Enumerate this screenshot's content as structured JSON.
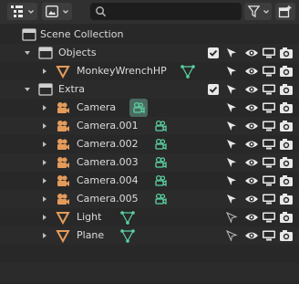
{
  "header": {
    "display_mode_icon": "outliner-icon",
    "filter_icon": "funnel-icon",
    "new_collection_icon": "new-collection-icon",
    "search": {
      "value": "",
      "placeholder": ""
    }
  },
  "tree": {
    "root": {
      "label": "Scene Collection"
    },
    "objects_collection": {
      "label": "Objects"
    },
    "monkey": {
      "label": "MonkeyWrenchHP"
    },
    "extra_collection": {
      "label": "Extra"
    },
    "camera": {
      "label": "Camera"
    },
    "camera001": {
      "label": "Camera.001"
    },
    "camera002": {
      "label": "Camera.002"
    },
    "camera003": {
      "label": "Camera.003"
    },
    "camera004": {
      "label": "Camera.004"
    },
    "camera005": {
      "label": "Camera.005"
    },
    "light": {
      "label": "Light"
    },
    "plane": {
      "label": "Plane"
    }
  },
  "colors": {
    "background": "#282828",
    "object_orange": "#e49b5a",
    "data_green": "#5ad2a0",
    "text": "#dcdcdc"
  }
}
